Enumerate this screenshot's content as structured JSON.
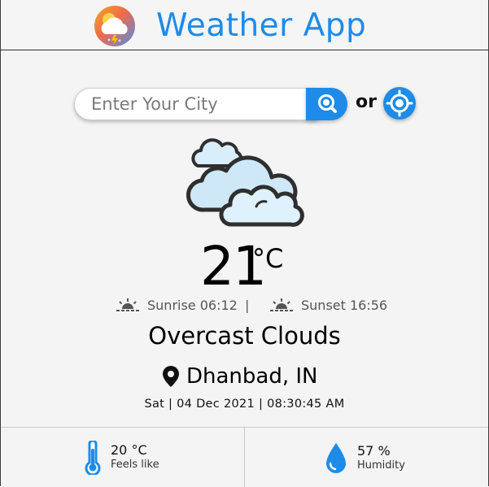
{
  "header": {
    "title": "Weather App",
    "logo_icon": "weather-logo-icon"
  },
  "search": {
    "placeholder": "Enter Your City",
    "button_icon": "search-icon",
    "or_label": "or",
    "location_icon": "locate-icon"
  },
  "current": {
    "weather_icon": "cloudy-icon",
    "temperature": "21",
    "unit": "°C",
    "sunrise": "Sunrise 06:12",
    "separator": "|",
    "sunset": "Sunset 16:56",
    "condition": "Overcast Clouds",
    "location": "Dhanbad, IN",
    "datetime": "Sat | 04 Dec 2021 | 08:30:45 AM"
  },
  "stats": {
    "feels_like_value": "20 °C",
    "feels_like_label": "Feels like",
    "humidity_value": "57 %",
    "humidity_label": "Humidity"
  },
  "colors": {
    "accent": "#1e8be8",
    "cloud_fill": "#cfe8f8",
    "background": "#f4f4f4"
  }
}
